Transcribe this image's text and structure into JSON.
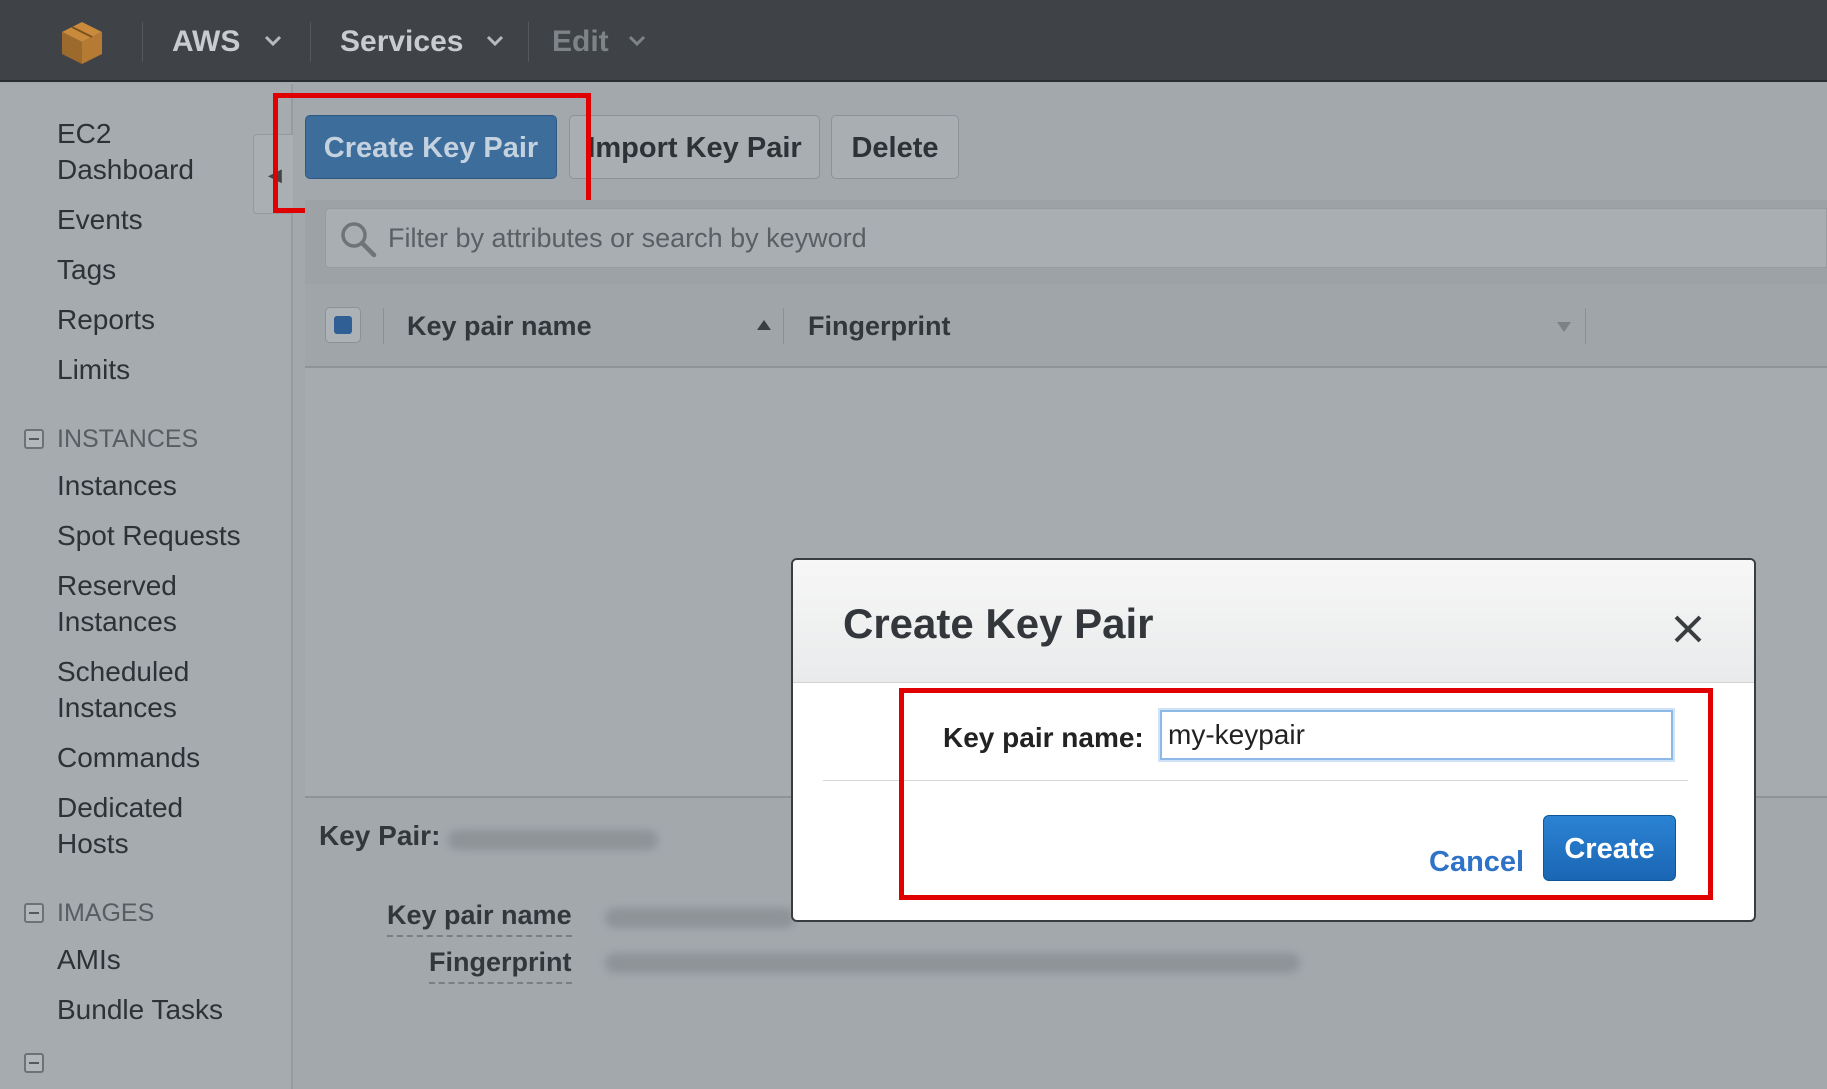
{
  "topnav": {
    "items": [
      {
        "label": "AWS"
      },
      {
        "label": "Services"
      },
      {
        "label": "Edit"
      }
    ]
  },
  "sidebar": {
    "links": [
      {
        "label": "EC2"
      },
      {
        "label": "Dashboard"
      },
      {
        "label": "Events"
      },
      {
        "label": "Tags"
      },
      {
        "label": "Reports"
      },
      {
        "label": "Limits"
      }
    ],
    "sections": [
      {
        "title": "INSTANCES",
        "items": [
          {
            "label": "Instances"
          },
          {
            "label": "Spot Requests"
          },
          {
            "label": "Reserved"
          },
          {
            "label": "Instances"
          },
          {
            "label": "Scheduled"
          },
          {
            "label": "Instances"
          },
          {
            "label": "Commands"
          },
          {
            "label": "Dedicated"
          },
          {
            "label": "Hosts"
          }
        ]
      },
      {
        "title": "IMAGES",
        "items": [
          {
            "label": "AMIs"
          },
          {
            "label": "Bundle Tasks"
          }
        ]
      }
    ]
  },
  "toolbar": {
    "create_label": "Create Key Pair",
    "import_label": "Import Key Pair",
    "delete_label": "Delete"
  },
  "search": {
    "placeholder": "Filter by attributes or search by keyword"
  },
  "table": {
    "columns": [
      {
        "label": "Key pair name"
      },
      {
        "label": "Fingerprint"
      }
    ]
  },
  "details": {
    "title": "Key Pair:",
    "fields": [
      {
        "label": "Key pair name"
      },
      {
        "label": "Fingerprint"
      }
    ]
  },
  "modal": {
    "title": "Create Key Pair",
    "field_label": "Key pair name:",
    "field_value": "my-keypair",
    "cancel_label": "Cancel",
    "create_label": "Create"
  },
  "colors": {
    "highlight": "#e00000",
    "primary": "#1f6fbf",
    "link": "#2f73c9"
  },
  "icons": {
    "logo": "aws-cube-logo",
    "search": "search-icon",
    "close": "close-icon",
    "chevron": "chevron-down-icon",
    "sort": "sort-asc-icon"
  }
}
